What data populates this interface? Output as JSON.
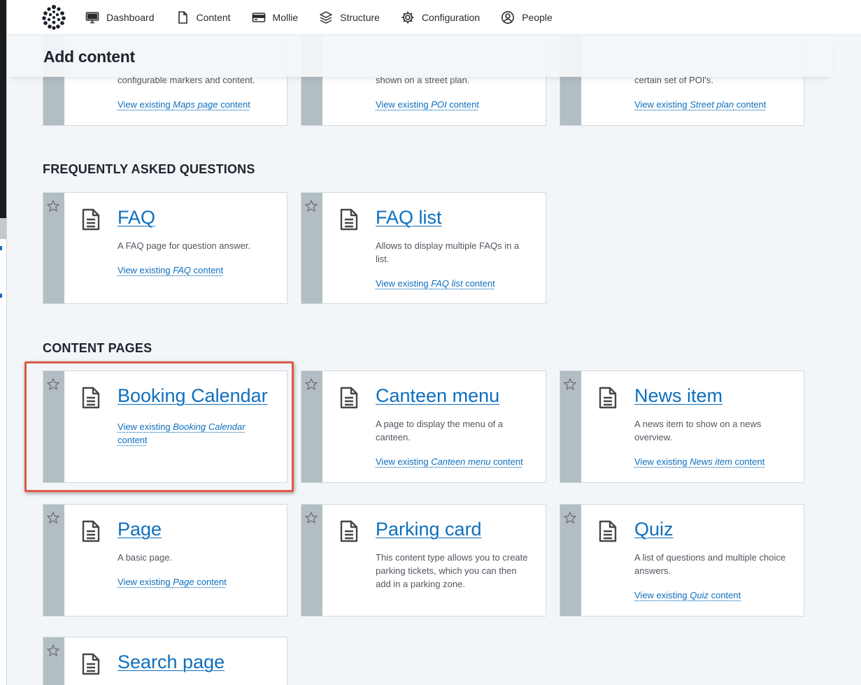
{
  "nav": {
    "items": [
      {
        "label": "Dashboard",
        "icon": "monitor-icon"
      },
      {
        "label": "Content",
        "icon": "file-icon"
      },
      {
        "label": "Mollie",
        "icon": "credit-card-icon"
      },
      {
        "label": "Structure",
        "icon": "layers-icon"
      },
      {
        "label": "Configuration",
        "icon": "gear-icon"
      },
      {
        "label": "People",
        "icon": "user-circle-icon"
      }
    ]
  },
  "page": {
    "title": "Add content"
  },
  "top_cards": [
    {
      "desc": "configurable markers and content.",
      "link_prefix": "View existing ",
      "link_type": "Maps page",
      "link_suffix": " content"
    },
    {
      "desc": "shown on a street plan.",
      "link_prefix": "View existing ",
      "link_type": "POI",
      "link_suffix": " content"
    },
    {
      "desc": "certain set of POI's.",
      "link_prefix": "View existing ",
      "link_type": "Street plan",
      "link_suffix": " content"
    }
  ],
  "sections": {
    "faq": {
      "title": "FREQUENTLY ASKED QUESTIONS",
      "cards": [
        {
          "title": "FAQ",
          "desc": "A FAQ page for question answer.",
          "link_prefix": "View existing ",
          "link_type": "FAQ",
          "link_suffix": " content"
        },
        {
          "title": "FAQ list",
          "desc": "Allows to display multiple FAQs in a list.",
          "link_prefix": "View existing ",
          "link_type": "FAQ list",
          "link_suffix": " content"
        }
      ]
    },
    "content_pages": {
      "title": "CONTENT PAGES",
      "cards": [
        {
          "title": "Booking Calendar",
          "desc": "",
          "link_prefix": "View existing ",
          "link_type": "Booking Calendar",
          "link_suffix": " content"
        },
        {
          "title": "Canteen menu",
          "desc": "A page to display the menu of a canteen.",
          "link_prefix": "View existing ",
          "link_type": "Canteen menu",
          "link_suffix": " content"
        },
        {
          "title": "News item",
          "desc": "A news item to show on a news overview.",
          "link_prefix": "View existing ",
          "link_type": "News item",
          "link_suffix": " content"
        },
        {
          "title": "Page",
          "desc": "A basic page.",
          "link_prefix": "View existing ",
          "link_type": "Page",
          "link_suffix": " content"
        },
        {
          "title": "Parking card",
          "desc": "This content type allows you to create parking tickets, which you can then add in a parking zone.",
          "link_prefix": "",
          "link_type": "",
          "link_suffix": ""
        },
        {
          "title": "Quiz",
          "desc": "A list of questions and multiple choice answers.",
          "link_prefix": "View existing ",
          "link_type": "Quiz",
          "link_suffix": " content"
        },
        {
          "title": "Search page",
          "desc": "",
          "link_prefix": "",
          "link_type": "",
          "link_suffix": ""
        }
      ]
    }
  },
  "colors": {
    "accent": "#0e6fbe",
    "card_bar": "#b2bec3",
    "highlight": "#e05848"
  }
}
